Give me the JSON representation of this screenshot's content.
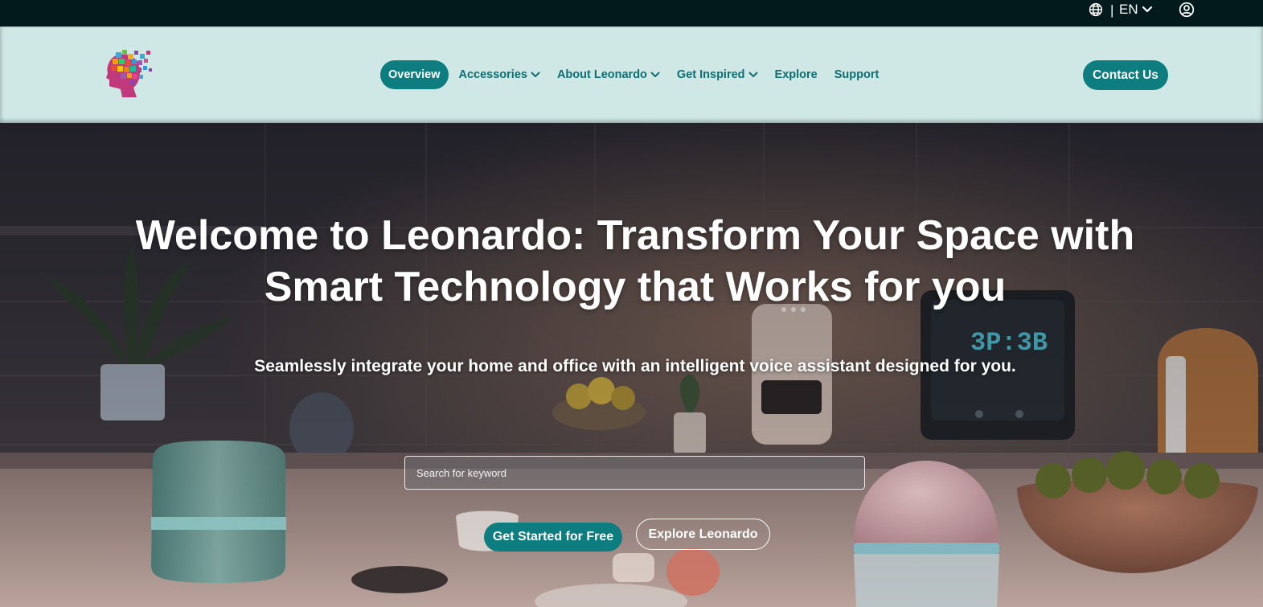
{
  "topbar": {
    "language_code": "EN",
    "separator": "|",
    "icons": [
      "globe-icon",
      "chevron-down-icon",
      "user-circle-icon"
    ]
  },
  "header": {
    "logo_icon": "pixel-head-logo",
    "nav": [
      {
        "label": "Overview",
        "active": true,
        "dropdown": false
      },
      {
        "label": "Accessories",
        "active": false,
        "dropdown": true
      },
      {
        "label": "About Leonardo",
        "active": false,
        "dropdown": true
      },
      {
        "label": "Get Inspired",
        "active": false,
        "dropdown": true
      },
      {
        "label": "Explore",
        "active": false,
        "dropdown": false
      },
      {
        "label": "Support",
        "active": false,
        "dropdown": false
      }
    ],
    "contact_label": "Contact Us"
  },
  "hero": {
    "title_line1": "Welcome to Leonardo: Transform Your Space with",
    "title_line2": "Smart Technology that Works for you",
    "subtitle": "Seamlessly integrate your home and office with an intelligent voice assistant designed for you.",
    "search_placeholder": "Search for keyword",
    "primary_cta": "Get Started for Free",
    "secondary_cta": "Explore Leonardo"
  },
  "colors": {
    "accent": "#0e7d80",
    "nav_text": "#0e6f73",
    "header_bg": "#cfe7e5",
    "topbar_bg": "#021a1b"
  }
}
